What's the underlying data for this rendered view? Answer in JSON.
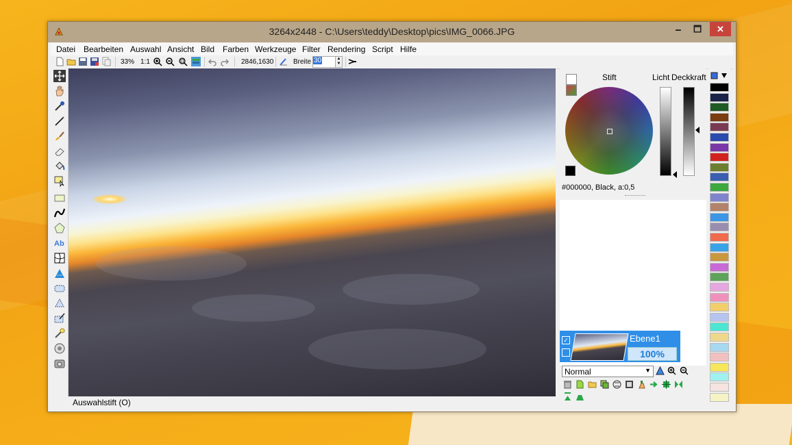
{
  "window": {
    "title": "3264x2448 - C:\\Users\\teddy\\Desktop\\pics\\IMG_0066.JPG",
    "minimize": "🗕",
    "maximize": "🗖",
    "close": "✕"
  },
  "menu": [
    "Datei",
    "Bearbeiten",
    "Auswahl",
    "Ansicht",
    "Bild",
    "Farben",
    "Werkzeuge",
    "Filter",
    "Rendering",
    "Script",
    "Hilfe"
  ],
  "toolbar": {
    "zoom": "33%",
    "ratio": "1:1",
    "coords": "2846,1630",
    "width_label": "Breite",
    "width_value": "30"
  },
  "tools": [
    "selection-move",
    "hand",
    "color-picker",
    "pencil",
    "brush",
    "eraser",
    "fill-bucket",
    "select-pen",
    "rectangle",
    "curve",
    "polygon",
    "text",
    "grid-transform",
    "gradient",
    "lasso",
    "magic-wand",
    "select-brush",
    "clone",
    "adjust",
    "photo"
  ],
  "colors": {
    "pen_label": "Stift",
    "light_label": "Licht",
    "opacity_label": "Deckkraft",
    "current": "#000000, Black, a:0,5",
    "primary": "#000000"
  },
  "layers": {
    "name": "Ebene1",
    "opacity": "100%",
    "blend_mode": "Normal"
  },
  "status": {
    "text": "Auswahlstift (O)"
  },
  "palette": [
    "#000000",
    "#1a2348",
    "#1e5a24",
    "#7a3c10",
    "#7a3a52",
    "#2a4cae",
    "#7b36a8",
    "#d2221e",
    "#6b7f2e",
    "#3a5fb0",
    "#3ca83e",
    "#7f84cc",
    "#b3826a",
    "#3c96e6",
    "#9a8eb0",
    "#f06a4c",
    "#39a3e8",
    "#c9973e",
    "#c86ad6",
    "#5ea35a",
    "#e6a6e0",
    "#ee92bd",
    "#f2ce6a",
    "#b6c4f0",
    "#4ce6d2",
    "#eed88a",
    "#a6d8f0",
    "#f2c0c0",
    "#f5e65a",
    "#a0f2f0",
    "#f5e4e0",
    "#f5f2c6"
  ]
}
